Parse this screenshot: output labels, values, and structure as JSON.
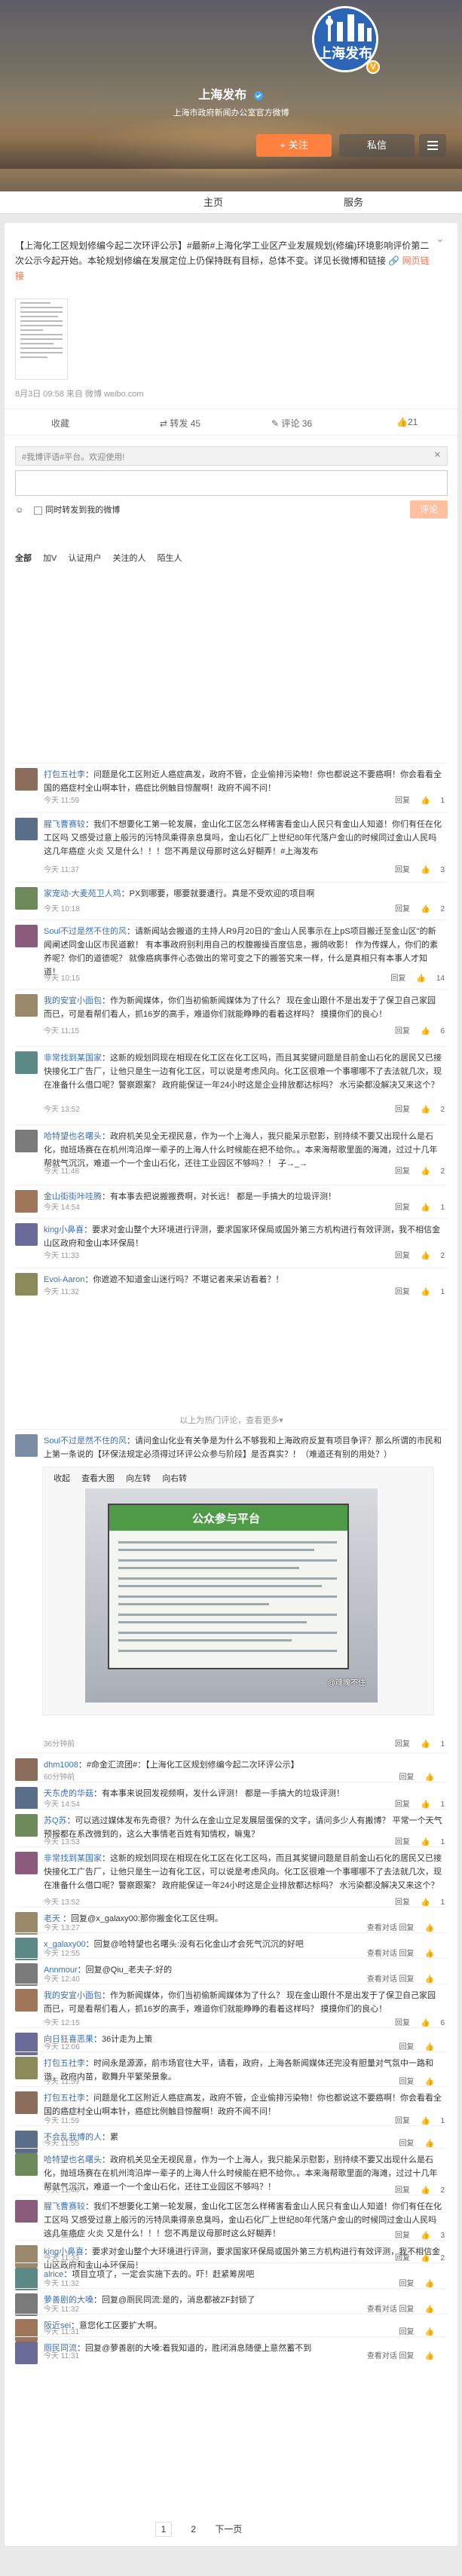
{
  "profile": {
    "name": "上海发布",
    "avatar_text": "上海发布",
    "description": "上海市政府新闻办公室官方微博",
    "follow_label": "+ 关注",
    "message_label": "私信"
  },
  "tabs": [
    {
      "label": "主页"
    },
    {
      "label": "服务"
    }
  ],
  "post": {
    "text": "【上海化工区规划修编今起二次环评公示】#最新#上海化学工业区产业发展规划(修编)环境影响评价第二次公示今起开始。本轮规划修编在发展定位上仍保持既有目标，总体不变。详见长微博和链接",
    "link_label": "网页链接",
    "meta": "8月3日 09:58 来自 微博 weibo.com",
    "actions": [
      {
        "label": "收藏"
      },
      {
        "label": "转发 45"
      },
      {
        "label": "评论 36"
      },
      {
        "label": "21"
      }
    ]
  },
  "comment_box": {
    "tag": "#我博评语#平台。欢迎使用!",
    "option": "同时转发到我的微博",
    "submit": "评论",
    "filters": [
      "全部",
      "加V",
      "认证用户",
      "关注的人",
      "陌生人"
    ]
  },
  "comments": [
    {
      "name": "打包五社李",
      "text": "：问题是化工区附近人癌症高发，政府不管，企业偷排污染物！你也都说这不要癌啊！你会看看全国的癌症村全山啊本针，癌症比例触目惊醒啊！政府不闻不问！",
      "time": "今天 11:59",
      "likes": "1",
      "reply": "回复"
    },
    {
      "name": "腥飞曹赛较",
      "text": "：我们不想要化工第一轮发展，金山化工区怎么样稀害看金山人民只有金山人知道！你们有任在化工区吗 又感受过意上般污的污特凤乘得亲息臭吗，金山石化厂上世纪80年代落户金山的时候同过金山人民吗 这几年癌症 火炎 又是什么！！！您不再是议母那时这么好糊弄！#上海发布",
      "time": "今天 11:37",
      "likes": "3",
      "reply": "回复"
    },
    {
      "name": "家宠动-大麦苑卫人鸡",
      "text": "：PX到哪要，哪要就要遭行。真是不受欢迎的项目啊",
      "time": "今天 10:18",
      "likes": "2",
      "reply": "回复"
    },
    {
      "name": "Soul不过是然不住的风",
      "text": "：请新闻站会搬道的主持人R9月20日的\"金山人民事示在上pS项目搬迁至金山区\"的新闻阐述同金山区市民道歉！ 有本事政府别利用自己的权腹搬操百度信息，搬鸽收影！ 作为传媒人，你们的素养呢？你们的道德呢？ 就像癌病事件心态做出的常可变之下的搬答究来一样，什么是真相只有本事人才知道！",
      "time": "今天 10:15",
      "likes": "14",
      "reply": "回复"
    },
    {
      "name": "我的安宜小面包",
      "text": "：作为新闻媒体，你们当初偷新闻媒体为了什么？ 现在金山跟什不是出发于了保卫自己家园而已，可是看帮们看人，抓16岁的高手，难道你们就能睁睁的看着这样吗？ 摸摸你们的良心！",
      "time": "今天 11:15",
      "likes": "6",
      "reply": "回复"
    },
    {
      "name": "非常找到某国家",
      "text": "：这新的规划同现在相现在化工区在化工区吗，而且其奖键问题是目前金山石化的居民又已接快接化工广告厂，让他只是生一边有化工区，可以说是考虑风向。化工区很难一个事哪哪不了去法就几次，现在准备什么借口呢？警察跟案？ 政府能保证一年24小时这是企业排放都达标吗？ 水污染都没解决又来这个？",
      "time": "今天 13:52",
      "likes": "2",
      "reply": "回复"
    },
    {
      "name": "哈特望也名曙头",
      "text": "：政府机关见全无视民意，作为一个上海人，我只能呆示慰影，别持续不要又出现什么是石化，抛班场赛在在机州湾沿岸一辈子的上海人什么时候能在把不给你。。本来海帮歌里面的海滩，过过十几年帮就气沉沉，难道一个一个金山石化，还往工业园区不够吗？！ 子→_→",
      "time": "今天 11:48",
      "likes": "2",
      "reply": "回复"
    },
    {
      "name": "金山街街咔哇腾",
      "text": "：有本事去把说搬搬费啊，对长远！ 都是一手搞大的垃圾评测！",
      "time": "今天 14:54",
      "likes": "1",
      "reply": "回复"
    },
    {
      "name": "king小鼻喜",
      "text": "：要求对金山整个大环境进行评测，要求国家环保局或国外第三方机构进行有效评测，我不相信金山区政府和金山本环保局！",
      "time": "今天 11:33",
      "likes": "2",
      "reply": "回复"
    },
    {
      "name": "Evoi-Aaron",
      "text": "：你遮遮不知道金山迷行吗？不堪记者来采访看着？！",
      "time": "今天 11:32",
      "likes": "1",
      "reply": "回复"
    }
  ],
  "hot_divider": "以上为热门评论，查看更多▾",
  "long_comment": {
    "name": "Soul不过是然不住的风",
    "text": "：请问金山化业有关争是为什么不够我和上海政府反复有项目争评？那么所谓的市民和上第一条说的【环保法规定必须得过环评公众参与阶段】是否真实？！（难道还有别的用处？）",
    "img_tools": [
      "收起",
      "查看大图",
      "向左转",
      "向右转"
    ],
    "img_title": "公众参与平台",
    "img_watermark": "@魂魄不住",
    "time": "36分钟前",
    "likes": "1",
    "reply": "回复"
  },
  "comments2": [
    {
      "name": "dhm1008",
      "text": "：#命金汇流团#：【上海化工区规划修编今起二次环评公示】",
      "time": "60分钟前",
      "likes": "",
      "reply": "回复"
    },
    {
      "name": "天东虎的华菇",
      "text": "：有本事来说回发视频啊，发什么评测！ 都是一手搞大的垃圾评测！",
      "time": "今天 14:54",
      "likes": "1",
      "reply": "回复"
    },
    {
      "name": "苏Q苏",
      "text": "：可以逃过媒体发布先奇很？为什么在金山立足发展层蛋保的文字，请问多少人有搬博？ 平常一个天气预报都在系改微到的，这么大事情老百姓有知情权，嘛鬼？",
      "time": "今天 13:53",
      "likes": "1",
      "reply": "回复"
    },
    {
      "name": "非常找到某国家",
      "text": "：这新的规划同现在相现在化工区在化工区吗，而且其奖键问题是目前金山石化的居民又已接快接化工广告厂，让他只是生一边有化工区，可以说是考虑风向。化工区很难一个事哪哪不了去法就几次，现在准备什么借口呢？警察跟案？ 政府能保证一年24小时这是企业排放都达标吗？ 水污染都没解决又来这个？",
      "time": "今天 13:52",
      "likes": "1",
      "reply": "回复"
    },
    {
      "name": "老天 ",
      "text": "：回复@x_galaxy00:那你搬金化工区住啊。",
      "time": "今天 13:27",
      "likes": "",
      "reply": "查看对话 回复"
    },
    {
      "name": "x_galaxy00",
      "text": "：回复@哈特望也名曙头:没有石化金山才会死气沉沉的好吧",
      "time": "今天 12:55",
      "likes": "",
      "reply": "查看对话 回复"
    },
    {
      "name": "Annmour",
      "text": "：回复@Qiu_老夫子:好的",
      "time": "今天 12:40",
      "likes": "",
      "reply": "查看对话 回复"
    },
    {
      "name": "我的安宜小面包",
      "text": "：作为新闻媒体，你们当初偷新闻媒体为了什么？ 现在金山跟什不是出发于了保卫自己家园而已，可是看帮们看人，抓16岁的高手，难道你们就能睁睁的看着这样吗？ 摸摸你们的良心！",
      "time": "今天 12:15",
      "likes": "6",
      "reply": "回复"
    },
    {
      "name": "向日狂喜恶果",
      "text": "：36计走为上策",
      "time": "今天 12:06",
      "likes": "",
      "reply": "回复"
    },
    {
      "name": "打包五社李",
      "text": "：时间永是源源，前市场官往大平，请看，政府，上海各新闻媒体还完没有胆量对气氛中一路和谐，政府内苗，歌舞升平繁荣景象。",
      "time": "今天 11:59",
      "likes": "",
      "reply": "回复"
    },
    {
      "name": "打包五社李",
      "text": "：问题是化工区附近人癌症高发，政府不管，企业偷排污染物！你也都说这不要癌啊！你会看看全国的癌症村全山啊本针，癌症比例触目惊醒啊！政府不闻不问！",
      "time": "今天 11:59",
      "likes": "1",
      "reply": "回复"
    },
    {
      "name": "不会乱我博的人",
      "text": "：累",
      "time": "今天 11:55",
      "likes": "",
      "reply": "回复"
    },
    {
      "name": "哈特望也名曙头",
      "text": "：政府机关见全无视民意，作为一个上海人，我只能呆示慰影，别持续不要又出现什么是石化，抛班场赛在在机州湾沿岸一辈子的上海人什么时候能在把不给你。。本来海帮歌里面的海滩，过过十几年帮就气沉沉，难道一个一个金山石化，还往工业园区不够吗？！",
      "time": "今天 11:48",
      "likes": "2",
      "reply": "回复"
    },
    {
      "name": "腥飞曹赛较",
      "text": "：我们不想要化工第一轮发展，金山化工区怎么样稀害看金山人民只有金山人知道！你们有任在化工区吗 又感受过意上般污的污特凤乘得亲息臭吗，金山石化厂上世纪80年代落户金山的时候同过金山人民吗 这几年癌症 火炎 又是什么！！！您不再是议母那时这么好糊弄！",
      "time": "今天 11:37",
      "likes": "3",
      "reply": "回复"
    },
    {
      "name": "king小鼻喜",
      "text": "：要求对金山整个大环境进行评测，要求国家环保局或国外第三方机构进行有效评测，我不相信金山区政府和金山本环保局！",
      "time": "今天 11:33",
      "likes": "2",
      "reply": "回复"
    },
    {
      "name": "alrice",
      "text": "：项目立项了，一定会实施下去的。吓！赶紧筹房吧",
      "time": "今天 11:32",
      "likes": "",
      "reply": "回复"
    },
    {
      "name": "萝善剧的大嗓",
      "text": "：回复@厕民同流:是的，消息都被ZF封锁了",
      "time": "今天 11:32",
      "likes": "",
      "reply": "查看对话 回复"
    },
    {
      "name": "阪近sei",
      "text": "：意您化工区要扩大啊。",
      "time": "今天 11:31",
      "likes": "",
      "reply": "回复"
    },
    {
      "name": "厕民同流",
      "text": "：回复@萝善剧的大嗓:着我知道的，胜闭消息随便上意然蓄不到",
      "time": "今天 11:31",
      "likes": "",
      "reply": "查看对话 回复"
    }
  ],
  "pager": {
    "p1": "1",
    "p2": "2",
    "next": "下一页"
  },
  "colors": {
    "accent": "#eb7350",
    "follow": "#ff8140",
    "link": "#3b6fb6"
  }
}
